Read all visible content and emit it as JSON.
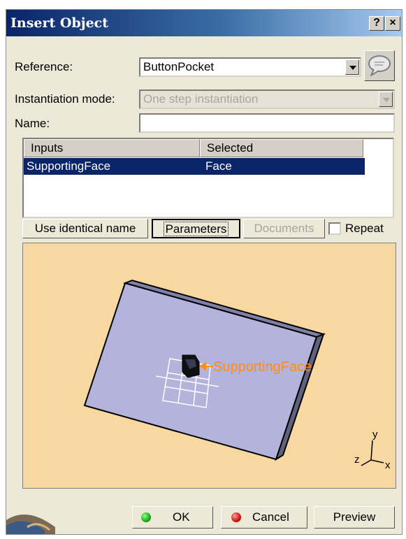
{
  "dialog": {
    "title": "Insert Object",
    "help_button": "?",
    "close_button": "×"
  },
  "reference": {
    "label": "Reference:",
    "value": "ButtonPocket"
  },
  "instantiation_mode": {
    "label": "Instantiation mode:",
    "value": "One step instantiation",
    "enabled": false
  },
  "name": {
    "label": "Name:",
    "value": ""
  },
  "inputs_table": {
    "columns": [
      "Inputs",
      "Selected"
    ],
    "rows": [
      {
        "input": "SupportingFace",
        "selected": "Face",
        "is_selected": true
      }
    ]
  },
  "option_buttons": {
    "use_identical_name": "Use identical name",
    "parameters": "Parameters",
    "documents": "Documents",
    "repeat_label": "Repeat",
    "repeat_checked": false
  },
  "preview": {
    "annotation_label": "SupportingFace",
    "axis_labels": {
      "x": "x",
      "y": "y",
      "z": "z"
    },
    "background_color": "#f6d8a0",
    "annotation_color": "#ff8c1a",
    "plate_color": "#b3b3dc"
  },
  "footer": {
    "ok": "OK",
    "cancel": "Cancel",
    "preview": "Preview",
    "ok_icon": "green-dot-icon",
    "cancel_icon": "red-dot-icon"
  },
  "colors": {
    "title_bar": "#0a246a",
    "selection": "#0a246a",
    "dialog_background": "#ece9d8"
  }
}
